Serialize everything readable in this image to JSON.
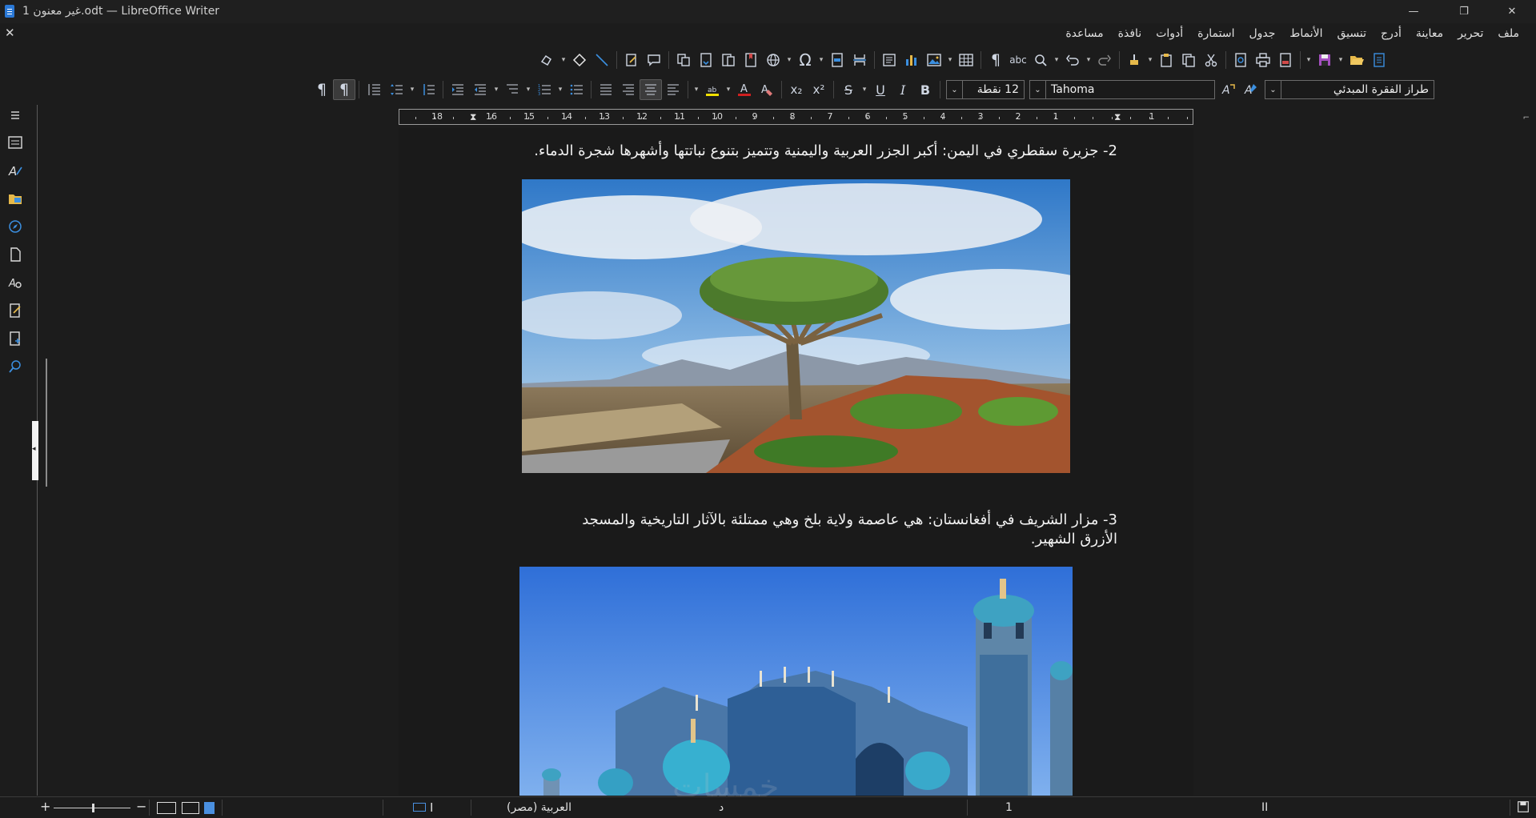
{
  "window": {
    "title": "غير معنون 1.odt — LibreOffice Writer",
    "minimize": "—",
    "maximize": "❐",
    "close": "✕"
  },
  "menubar": {
    "items": [
      "ملف",
      "تحرير",
      "معاينة",
      "أدرج",
      "تنسيق",
      "الأنماط",
      "جدول",
      "استمارة",
      "أدوات",
      "نافذة",
      "مساعدة"
    ],
    "close_doc": "✕"
  },
  "formatting": {
    "paragraph_style": "طراز الفقرة المبدئي",
    "font_name": "Tahoma",
    "font_size": "12 نقطة",
    "bold": "B",
    "italic": "I",
    "underline": "U",
    "strike": "S",
    "subscript": "x₂",
    "superscript": "x²"
  },
  "ruler": {
    "labels": [
      "18",
      "16",
      "15",
      "14",
      "13",
      "12",
      "11",
      "10",
      "9",
      "8",
      "7",
      "6",
      "5",
      "4",
      "3",
      "2",
      "1",
      "1"
    ]
  },
  "document": {
    "para2": "2- جزيرة سقطري في اليمن: أكبر الجزر العربية واليمنية وتتميز بتنوع نباتتها وأشهرها شجرة الدماء.",
    "para3_line1": "3- مزار الشريف في أفغانستان: هي عاصمة ولاية بلخ وهي ممتلئة بالآثار التاريخية والمسجد",
    "para3_line2": "الأزرق الشهير."
  },
  "statusbar": {
    "zoom_plus": "+",
    "zoom_minus": "−",
    "language": "العربية (مصر)",
    "word_count_marker": "د",
    "page_indicator": "1",
    "selection_mode": "II"
  },
  "watermark": "خمسات",
  "colors": {
    "accent": "#2a78d6",
    "background": "#1c1c1c",
    "document_bg": "#1a1a1a"
  }
}
